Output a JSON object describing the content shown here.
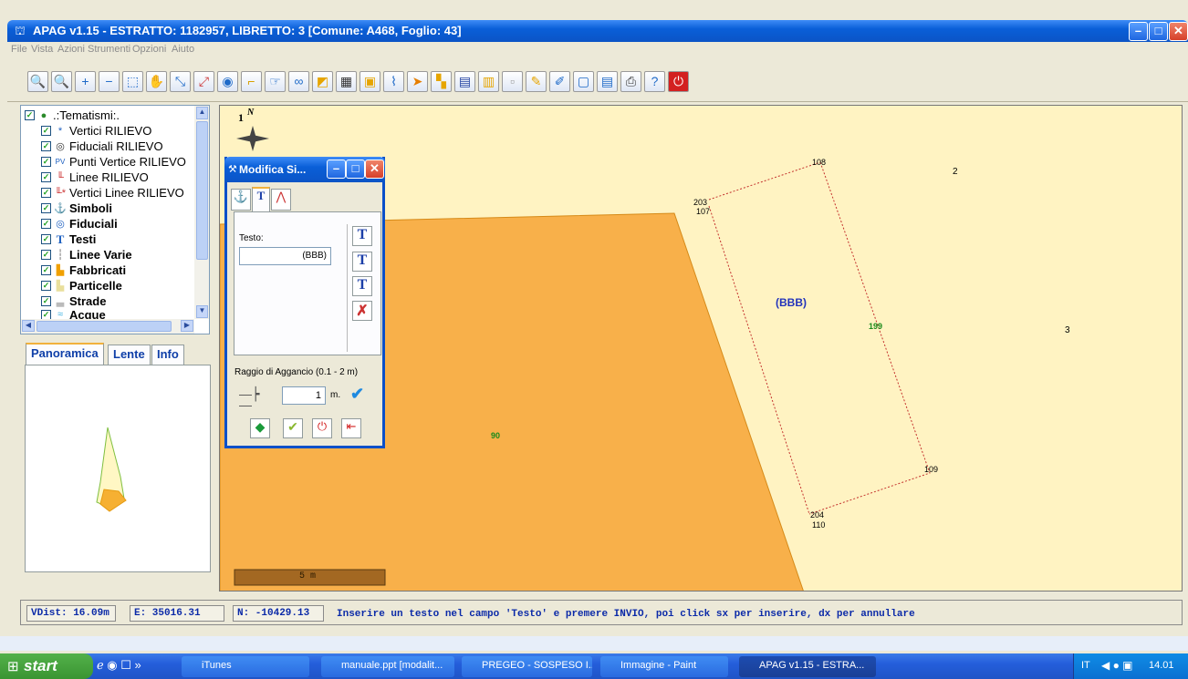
{
  "window": {
    "title": "APAG v1.15 - ESTRATTO: 1182957, LIBRETTO: 3 [Comune: A468, Foglio: 43]"
  },
  "menu": [
    "File",
    "Vista",
    "Azioni",
    "Strumenti",
    "Opzioni",
    "Aiuto"
  ],
  "tree": {
    "root": ".:Tematismi:.",
    "items": [
      {
        "label": "Vertici RILIEVO",
        "icon": "asterisk-icon"
      },
      {
        "label": "Fiduciali RILIEVO",
        "icon": "target-icon"
      },
      {
        "label": "Punti Vertice RILIEVO",
        "icon": "pv-icon"
      },
      {
        "label": "Linee RILIEVO",
        "icon": "line-icon"
      },
      {
        "label": "Vertici Linee RILIEVO",
        "icon": "line-vertex-icon"
      },
      {
        "label": "Simboli",
        "icon": "anchor-icon"
      },
      {
        "label": "Fiduciali",
        "icon": "target-icon"
      },
      {
        "label": "Testi",
        "icon": "text-icon"
      },
      {
        "label": "Linee Varie",
        "icon": "dashed-line-icon"
      },
      {
        "label": "Fabbricati",
        "icon": "building-icon"
      },
      {
        "label": "Particelle",
        "icon": "parcel-icon"
      },
      {
        "label": "Strade",
        "icon": "road-icon"
      },
      {
        "label": "Acque",
        "icon": "water-icon"
      }
    ]
  },
  "tabs": [
    "Panoramica",
    "Lente",
    "Info"
  ],
  "dialog": {
    "title": "Modifica Si...",
    "testo_label": "Testo:",
    "testo_value": "(BBB)",
    "raggio_label": "Raggio di Aggancio (0.1 - 2 m)",
    "raggio_value": "1",
    "raggio_unit": "m."
  },
  "map": {
    "north": "N",
    "compass_num": "1",
    "labels": {
      "p108": "108",
      "p203": "203",
      "p107": "107",
      "p2": "2",
      "bbb": "(BBB)",
      "p199": "199",
      "p3": "3",
      "p90": "90",
      "p109": "109",
      "p204": "204",
      "p110": "110"
    },
    "scale": "5 m"
  },
  "status": {
    "vdist": "VDist: 16.09m",
    "e": "E: 35016.31",
    "n": "N: -10429.13",
    "message": "Inserire un testo nel campo 'Testo' e premere INVIO, poi click sx per inserire, dx per annullare"
  },
  "taskbar": {
    "start": "start",
    "tasks": [
      "iTunes",
      "manuale.ppt [modalit...",
      "PREGEO - SOSPESO I...",
      "Immagine - Paint",
      "APAG v1.15 - ESTRA..."
    ],
    "lang": "IT",
    "time": "14.01"
  },
  "colors": {
    "titlebar": "#0a5fd8",
    "map_bg": "#fff3c2",
    "parcel": "#f8b04a",
    "status_text": "#0b2aa8"
  }
}
